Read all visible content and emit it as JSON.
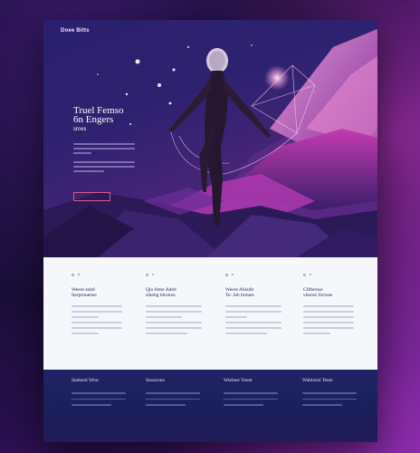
{
  "nav": {
    "logo": "Doee Bitts",
    "links": [
      "",
      "",
      "",
      ""
    ],
    "cta": ""
  },
  "hero": {
    "title_lines": [
      "Truel Femso",
      "6n Engers",
      "sroes"
    ],
    "button_label": ""
  },
  "features": [
    {
      "title_lines": [
        "Weere snlef",
        "Iterprnuenee"
      ]
    },
    {
      "title_lines": [
        "Qio feme Adelt",
        "sihehg ldruires"
      ]
    },
    {
      "title_lines": [
        "Weere Ahlsdit",
        "Te: Jeb itntues"
      ]
    },
    {
      "title_lines": [
        "Cllfternse",
        "vheore Sicrese"
      ]
    }
  ],
  "footer": {
    "columns": [
      {
        "title": "Snekenl Wior"
      },
      {
        "title": "Snuorons"
      },
      {
        "title": "Wieleee Yoeet"
      },
      {
        "title": "Wabiornl Teme"
      }
    ]
  },
  "colors": {
    "accent": "#d6588e",
    "hero_bg": "#2e2270",
    "feature_bg": "#f6f7fb",
    "footer_bg": "#1f2466"
  }
}
